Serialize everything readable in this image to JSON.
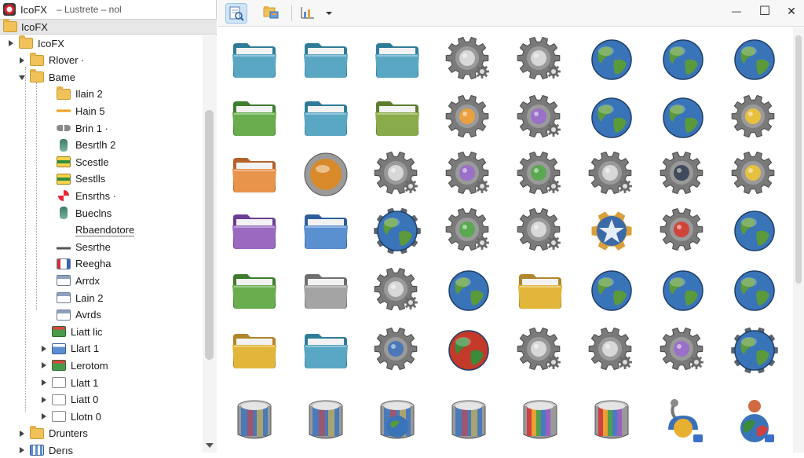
{
  "app": {
    "title": "IcoFX",
    "title_suffix": "– Lustrete – nol",
    "root_label": "IcoFX"
  },
  "colors": {
    "accent": "#cfe4f7",
    "folder": "#f2c25a",
    "selection_bg": "#e7e7e7"
  },
  "tree": {
    "items": [
      {
        "label": "IcoFX",
        "icon": "folder-icon",
        "caret": "closed",
        "level": 0
      },
      {
        "label": "Rlover ·",
        "icon": "folder-icon",
        "caret": "closed",
        "level": 1
      },
      {
        "label": "Bame",
        "icon": "folder-icon",
        "caret": "open",
        "level": 1
      },
      {
        "label": "Ilain 2",
        "icon": "folder-icon",
        "caret": "none",
        "level": 3
      },
      {
        "label": "Hain 5",
        "icon": "line-icon",
        "caret": "none",
        "level": 3
      },
      {
        "label": "Brin 1 ·",
        "icon": "link-icon",
        "caret": "none",
        "level": 3
      },
      {
        "label": "Besrtlh 2",
        "icon": "bottle-icon",
        "caret": "none",
        "level": 3
      },
      {
        "label": "Scestle",
        "icon": "box-icon",
        "caret": "none",
        "level": 3
      },
      {
        "label": "Sestlls",
        "icon": "box-icon",
        "caret": "none",
        "level": 3
      },
      {
        "label": "Ensrths ·",
        "icon": "fan-icon",
        "caret": "none",
        "level": 3
      },
      {
        "label": "Bueclns",
        "icon": "bottle-icon",
        "caret": "none",
        "level": 3
      },
      {
        "label": "Rbaendotore",
        "icon": "",
        "caret": "none",
        "level": 3
      },
      {
        "label": "Sesrthe",
        "icon": "bar-icon",
        "caret": "none",
        "level": 3
      },
      {
        "label": "Reegha",
        "icon": "panel-icon",
        "caret": "none",
        "level": 3
      },
      {
        "label": "Arrdx",
        "icon": "window-icon",
        "caret": "none",
        "level": 3
      },
      {
        "label": "Lain 2",
        "icon": "window-icon",
        "caret": "none",
        "level": 3
      },
      {
        "label": "Avrds",
        "icon": "window-icon",
        "caret": "none",
        "level": 3
      },
      {
        "label": "Liatt lic",
        "icon": "green-icon",
        "caret": "none",
        "level": 2
      },
      {
        "label": "Llart 1",
        "icon": "blue-icon",
        "caret": "closed",
        "level": 2
      },
      {
        "label": "Lerotom",
        "icon": "green-icon",
        "caret": "closed",
        "level": 2
      },
      {
        "label": "Llatt 1",
        "icon": "doc-icon",
        "caret": "closed",
        "level": 2
      },
      {
        "label": "Liatt 0",
        "icon": "doc-icon",
        "caret": "closed",
        "level": 2
      },
      {
        "label": "Llotn 0",
        "icon": "doc-icon",
        "caret": "closed",
        "level": 2
      },
      {
        "label": "Drunters",
        "icon": "folder-icon",
        "caret": "closed",
        "level": 1
      },
      {
        "label": "Derıs",
        "icon": "grid-icon",
        "caret": "closed",
        "level": 1
      }
    ]
  },
  "toolbar": {
    "buttons": [
      "search-view-icon",
      "folder-view-icon",
      "chart-icon",
      "dropdown-icon"
    ],
    "window": {
      "minimize": "—",
      "maximize": "☐",
      "close": "✕"
    }
  },
  "gallery": {
    "rows": [
      [
        "folder-teal",
        "folder-teal",
        "folder-teal",
        "gear-gray",
        "gear-gray",
        "globe",
        "globe",
        "globe"
      ],
      [
        "folder-green",
        "folder-teal",
        "folder-olive",
        "gear-orange",
        "gear-purple",
        "globe",
        "globe",
        "gear-yellow"
      ],
      [
        "folder-orange",
        "orb-orange",
        "gear-gray",
        "gear-purple",
        "gear-green",
        "gear-gray",
        "gear-dark",
        "gear-yellow"
      ],
      [
        "folder-purple",
        "folder-blue",
        "globe-gear",
        "gear-green",
        "gear-gray",
        "star-badge",
        "gear-red",
        "globe"
      ],
      [
        "folder-green",
        "folder-gray",
        "gear-gray",
        "globe",
        "folder-yellow",
        "globe",
        "globe",
        "globe"
      ],
      [
        "folder-yellow",
        "folder-teal",
        "gear-blue",
        "globe-color",
        "gear-gray",
        "gear-gray",
        "gear-purple",
        "globe-gear"
      ],
      [
        "drum-blue",
        "drum-blue",
        "globe-drum",
        "drum-globe",
        "drum-rainbow",
        "drum-rainbow",
        "lamp-yellow",
        "robot-globe"
      ]
    ]
  }
}
